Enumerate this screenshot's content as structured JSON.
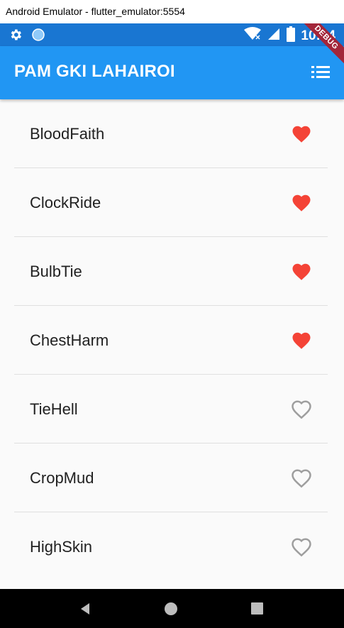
{
  "window": {
    "title": "Android Emulator - flutter_emulator:5554"
  },
  "status_bar": {
    "time": "10:04",
    "icons": [
      "settings-icon",
      "circle-icon",
      "wifi-icon",
      "signal-icon",
      "battery-icon"
    ]
  },
  "app_bar": {
    "title": "PAM GKI LAHAIROI",
    "menu_icon": "list-icon",
    "debug_banner": "DEBUG"
  },
  "colors": {
    "status_bar": "#1976d2",
    "app_bar": "#2196f3",
    "heart_filled": "#f44336",
    "heart_outline": "#9e9e9e",
    "debug_banner": "#a3263a"
  },
  "items": [
    {
      "label": "BloodFaith",
      "favorite": true
    },
    {
      "label": "ClockRide",
      "favorite": true
    },
    {
      "label": "BulbTie",
      "favorite": true
    },
    {
      "label": "ChestHarm",
      "favorite": true
    },
    {
      "label": "TieHell",
      "favorite": false
    },
    {
      "label": "CropMud",
      "favorite": false
    },
    {
      "label": "HighSkin",
      "favorite": false
    }
  ],
  "nav_bar": {
    "icons": [
      "back-icon",
      "home-icon",
      "recents-icon"
    ]
  }
}
